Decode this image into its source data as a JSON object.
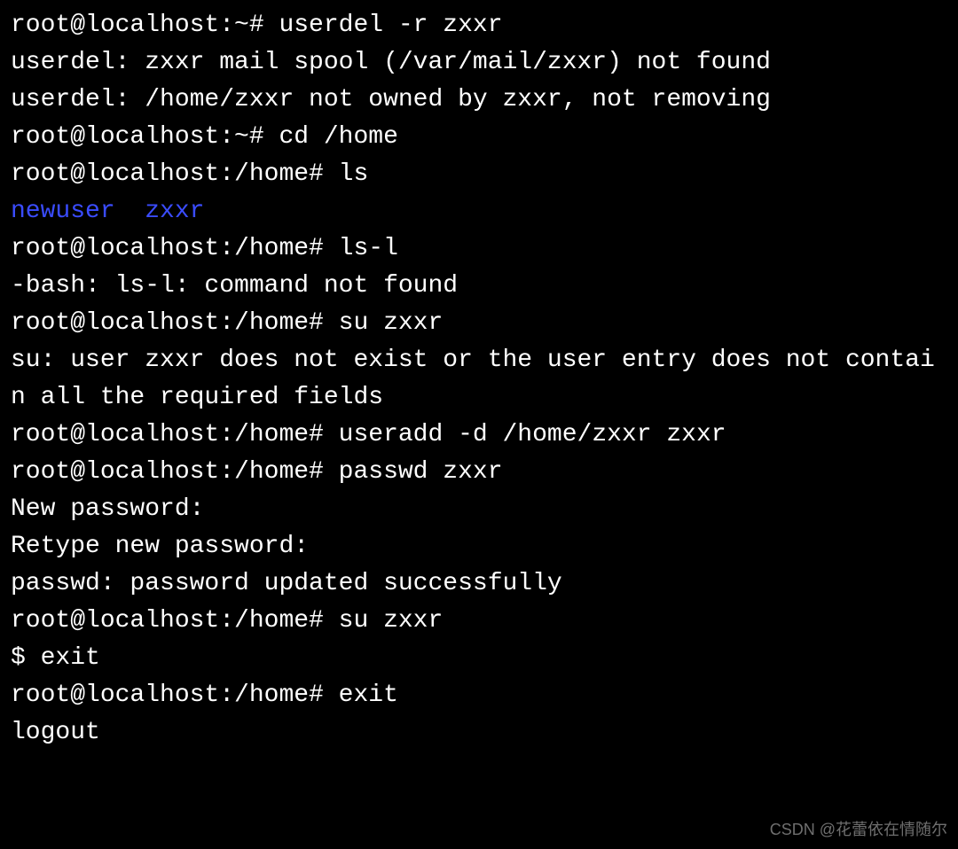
{
  "lines": {
    "l1_prompt": "root@localhost:~# ",
    "l1_cmd": "userdel -r zxxr",
    "l2": "userdel: zxxr mail spool (/var/mail/zxxr) not found",
    "l3": "userdel: /home/zxxr not owned by zxxr, not removing",
    "l4_prompt": "root@localhost:~# ",
    "l4_cmd": "cd /home",
    "l5_prompt": "root@localhost:/home# ",
    "l5_cmd": "ls",
    "l6_dir1": "newuser",
    "l6_sep": "  ",
    "l6_dir2": "zxxr",
    "l7_prompt": "root@localhost:/home# ",
    "l7_cmd": "ls-l",
    "l8": "-bash: ls-l: command not found",
    "l9_prompt": "root@localhost:/home# ",
    "l9_cmd": "su zxxr",
    "l10": "su: user zxxr does not exist or the user entry does not contain all the required fields",
    "l11_prompt": "root@localhost:/home# ",
    "l11_cmd": "useradd -d /home/zxxr zxxr",
    "l12_prompt": "root@localhost:/home# ",
    "l12_cmd": "passwd zxxr",
    "l13": "New password: ",
    "l14": "Retype new password: ",
    "l15": "passwd: password updated successfully",
    "l16_prompt": "root@localhost:/home# ",
    "l16_cmd": "su zxxr",
    "l17_prompt": "$ ",
    "l17_cmd": "exit",
    "l18_prompt": "root@localhost:/home# ",
    "l18_cmd": "exit",
    "l19": "logout"
  },
  "watermark": "CSDN @花蕾依在情随尔"
}
